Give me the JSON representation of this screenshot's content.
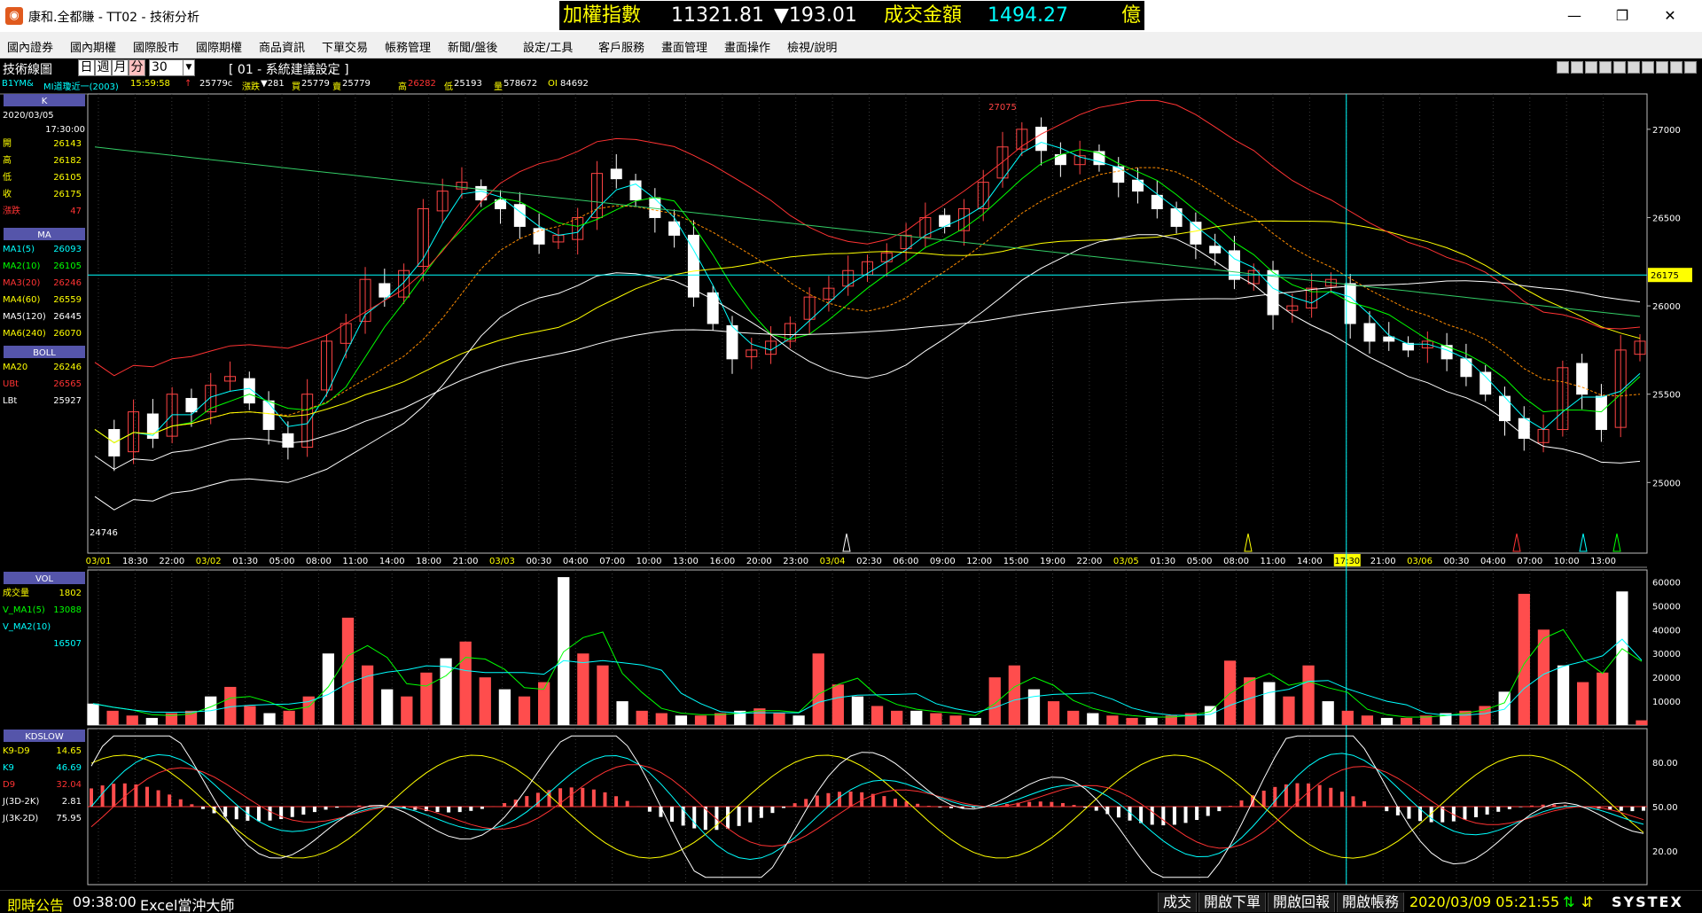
{
  "window": {
    "title": "康和.全都賺 - TT02 - 技術分析",
    "icon": "app-logo-icon"
  },
  "ticker": {
    "index_label": "加權指數",
    "index_value": "11321.81",
    "change": "▼193.01",
    "turnover_label": "成交金額",
    "turnover_value": "1494.27",
    "unit": "億"
  },
  "menu": [
    "國內證券",
    "國內期權",
    "國際股市",
    "國際期權",
    "商品資訊",
    "下單交易",
    "帳務管理",
    "新聞/盤後",
    "設定/工具",
    "客戶服務",
    "畫面管理",
    "畫面操作",
    "檢視/說明"
  ],
  "toolbar": {
    "title": "技術線圖",
    "periods": [
      "日",
      "週",
      "月",
      "分"
    ],
    "active_period": "分",
    "interval": "30",
    "template_label": "[ 01 - 系統建議設定 ]"
  },
  "quote": {
    "symbol": "B1YM&",
    "name": "MI道瓊近一(2003)",
    "time": "15:59:58",
    "arrow": "↑",
    "price": "25779c",
    "chg_label": "漲跌",
    "chg_value": "▼281",
    "bid_label": "買",
    "bid": "25779",
    "ask_label": "賣",
    "ask": "25779",
    "high_label": "高",
    "high": "26282",
    "low_label": "低",
    "low": "25193",
    "vol_label": "量",
    "vol": "578672",
    "oi_label": "OI",
    "oi": "84692"
  },
  "sidebar_k": {
    "header": "K",
    "date": "2020/03/05",
    "time": "17:30:00",
    "rows": [
      {
        "label": "開",
        "value": "26143",
        "color": "#ffff00"
      },
      {
        "label": "高",
        "value": "26182",
        "color": "#ffff00"
      },
      {
        "label": "低",
        "value": "26105",
        "color": "#ffff00"
      },
      {
        "label": "收",
        "value": "26175",
        "color": "#ffff00"
      },
      {
        "label": "漲跌",
        "value": "47",
        "color": "#ff3333"
      }
    ]
  },
  "sidebar_ma": {
    "header": "MA",
    "rows": [
      {
        "label": "MA1(5)",
        "value": "26093",
        "color": "#00ffff"
      },
      {
        "label": "MA2(10)",
        "value": "26105",
        "color": "#00ff00"
      },
      {
        "label": "MA3(20)",
        "value": "26246",
        "color": "#ff3333"
      },
      {
        "label": "MA4(60)",
        "value": "26559",
        "color": "#ffff00"
      },
      {
        "label": "MA5(120)",
        "value": "26445",
        "color": "#ffffff"
      },
      {
        "label": "MA6(240)",
        "value": "26070",
        "color": "#ffff00"
      }
    ]
  },
  "sidebar_boll": {
    "header": "BOLL",
    "rows": [
      {
        "label": "MA20",
        "value": "26246",
        "color": "#ffff00"
      },
      {
        "label": "UBt",
        "value": "26565",
        "color": "#ff3333"
      },
      {
        "label": "LBt",
        "value": "25927",
        "color": "#ffffff"
      }
    ]
  },
  "sidebar_vol": {
    "header": "VOL",
    "rows": [
      {
        "label": "成交量",
        "value": "1802",
        "color": "#ffff00"
      },
      {
        "label": "V_MA1(5)",
        "value": "13088",
        "color": "#00ff00"
      },
      {
        "label": "V_MA2(10)",
        "value": "",
        "color": "#00ffff"
      },
      {
        "label": "",
        "value": "16507",
        "color": "#00ffff"
      }
    ]
  },
  "sidebar_kd": {
    "header": "KDSLOW",
    "rows": [
      {
        "label": "K9-D9",
        "value": "14.65",
        "color": "#ffff00"
      },
      {
        "label": "K9",
        "value": "46.69",
        "color": "#00ffff"
      },
      {
        "label": "D9",
        "value": "32.04",
        "color": "#ff3333"
      },
      {
        "label": "J(3D-2K)",
        "value": "2.81",
        "color": "#ffffff"
      },
      {
        "label": "J(3K-2D)",
        "value": "75.95",
        "color": "#ffffff"
      }
    ]
  },
  "chart_data": {
    "type": "candlestick",
    "price_axis": {
      "ticks": [
        "27000",
        "26500",
        "26000",
        "25500",
        "25000"
      ],
      "range": [
        24600,
        27200
      ]
    },
    "current_price_tag": "26175",
    "high_annotation": "27075",
    "low_annotation": "24746",
    "x_labels": [
      {
        "text": "03/01",
        "color": "#ffff00"
      },
      {
        "text": "18:30"
      },
      {
        "text": "22:00"
      },
      {
        "text": "03/02",
        "color": "#ffff00"
      },
      {
        "text": "01:30"
      },
      {
        "text": "05:00"
      },
      {
        "text": "08:00"
      },
      {
        "text": "11:00"
      },
      {
        "text": "14:00"
      },
      {
        "text": "18:00"
      },
      {
        "text": "21:00"
      },
      {
        "text": "03/03",
        "color": "#ffff00"
      },
      {
        "text": "00:30"
      },
      {
        "text": "04:00"
      },
      {
        "text": "07:00"
      },
      {
        "text": "10:00"
      },
      {
        "text": "13:00"
      },
      {
        "text": "16:00"
      },
      {
        "text": "20:00"
      },
      {
        "text": "23:00"
      },
      {
        "text": "03/04",
        "color": "#ffff00"
      },
      {
        "text": "02:30"
      },
      {
        "text": "06:00"
      },
      {
        "text": "09:00"
      },
      {
        "text": "12:00"
      },
      {
        "text": "15:00"
      },
      {
        "text": "19:00"
      },
      {
        "text": "22:00"
      },
      {
        "text": "03/05",
        "color": "#ffff00"
      },
      {
        "text": "01:30"
      },
      {
        "text": "05:00"
      },
      {
        "text": "08:00"
      },
      {
        "text": "11:00"
      },
      {
        "text": "14:00"
      },
      {
        "text": "17:30",
        "highlight": true
      },
      {
        "text": "21:00"
      },
      {
        "text": "03/06",
        "color": "#ffff00"
      },
      {
        "text": "00:30"
      },
      {
        "text": "04:00"
      },
      {
        "text": "07:00"
      },
      {
        "text": "10:00"
      },
      {
        "text": "13:00"
      }
    ],
    "close_path": [
      25300,
      25150,
      25400,
      25250,
      25500,
      25400,
      25550,
      25600,
      25450,
      25300,
      25200,
      25500,
      25800,
      25900,
      26150,
      26050,
      26200,
      26550,
      26650,
      26700,
      26600,
      26550,
      26450,
      26350,
      26400,
      26500,
      26750,
      26720,
      26600,
      26500,
      26400,
      26050,
      25900,
      25700,
      25750,
      25800,
      25900,
      26050,
      26100,
      26200,
      26250,
      26300,
      26400,
      26500,
      26450,
      26550,
      26700,
      26900,
      27000,
      26880,
      26800,
      26850,
      26800,
      26700,
      26650,
      26550,
      26450,
      26350,
      26300,
      26150,
      26200,
      25950,
      26000,
      26100,
      26150,
      25900,
      25800,
      25800,
      25750,
      25800,
      25700,
      25600,
      25500,
      25350,
      25250,
      25300,
      25650,
      25500,
      25300,
      25750,
      25800
    ],
    "volume_axis": {
      "ticks": [
        "60000",
        "50000",
        "40000",
        "30000",
        "20000",
        "10000"
      ]
    },
    "volume_path": [
      9000,
      6000,
      4000,
      3000,
      5000,
      6000,
      12000,
      16000,
      8000,
      5000,
      6000,
      12000,
      30000,
      45000,
      25000,
      15000,
      12000,
      22000,
      28000,
      35000,
      20000,
      15000,
      12000,
      18000,
      62000,
      30000,
      25000,
      10000,
      6000,
      5000,
      4000,
      4000,
      5000,
      6000,
      7000,
      5000,
      4000,
      30000,
      17000,
      12000,
      8000,
      6000,
      6000,
      5000,
      4000,
      3000,
      20000,
      25000,
      15000,
      10000,
      6000,
      5000,
      4000,
      3000,
      3000,
      4000,
      5000,
      8000,
      27000,
      20000,
      18000,
      12000,
      25000,
      10000,
      6000,
      4000,
      3000,
      3000,
      4000,
      5000,
      6000,
      8000,
      14000,
      55000,
      40000,
      25000,
      18000,
      22000,
      56000,
      2000
    ],
    "kd_axis": {
      "ticks": [
        "80.00",
        "50.00",
        "20.00"
      ]
    }
  },
  "statusbar": {
    "notice_label": "即時公告",
    "notice_time": "09:38:00",
    "notice_text": "Excel當沖大師",
    "btn_trades": "成交",
    "btn_order": "開啟下單",
    "btn_report": "開啟回報",
    "btn_account": "開啟帳務",
    "clock": "2020/03/09 05:21:55",
    "brand": "SYSTEX"
  }
}
